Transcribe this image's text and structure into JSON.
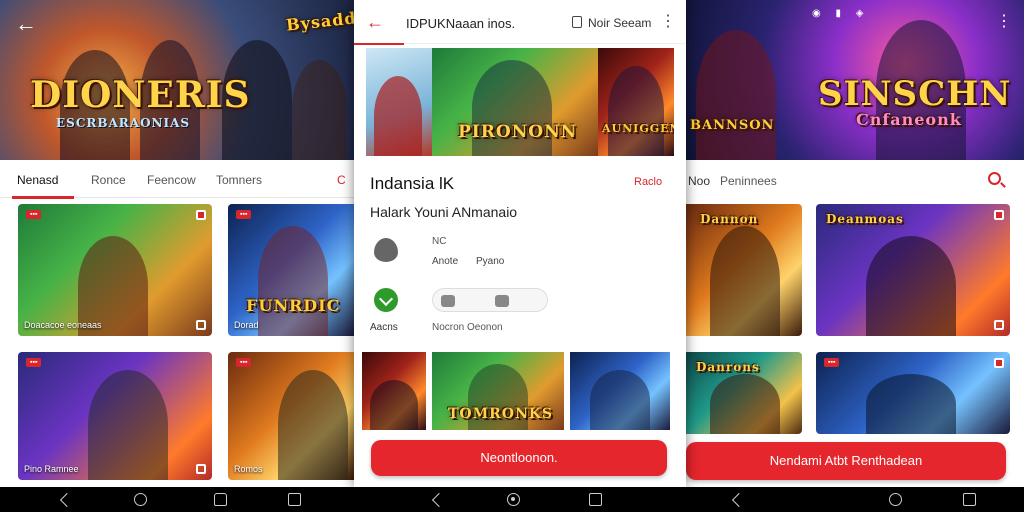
{
  "left": {
    "hero_title": "DIONERIS",
    "hero_subtitle": "ESCRBARAONIAS",
    "hero_badge": "Bysadd",
    "tabs": [
      {
        "label": "Nenasd"
      },
      {
        "label": "Ronce"
      },
      {
        "label": "Feencow"
      },
      {
        "label": "Tomners"
      },
      {
        "label": "C"
      }
    ],
    "cards": [
      {
        "caption": "Doacacoe eoneaas"
      },
      {
        "caption": "Dorad"
      },
      {
        "caption": "Pino Ramnee"
      },
      {
        "caption": "Romos"
      }
    ],
    "card_logo_2": "FUNRDIC"
  },
  "middle": {
    "title": "IDPUKNaaan inos.",
    "user": "Noir Seeam",
    "banner_logo_1": "PIRONONN",
    "banner_logo_2": "AUNIGGEN",
    "heading": "Indansia  lK",
    "radio_label": "Raclo",
    "subheading": "Halark Youni ANmanaio",
    "meta_top": "NC",
    "meta_a": "Anote",
    "meta_b": "Pyano",
    "label_1": "Aacns",
    "label_2": "Nocron Oeonon",
    "strip_logo": "TOMRONKS",
    "cta": "Neontloonon."
  },
  "right": {
    "hero_title": "SINSCHN",
    "hero_subtitle": "Cnfaneonk",
    "hero_small": "BANNSON",
    "tabs": [
      {
        "label": "Noo"
      },
      {
        "label": "Peninnees"
      }
    ],
    "card_logos": [
      "Dannon",
      "Deanmoas",
      "Danrons"
    ],
    "cta": "Nendami Atbt Renthadean"
  }
}
